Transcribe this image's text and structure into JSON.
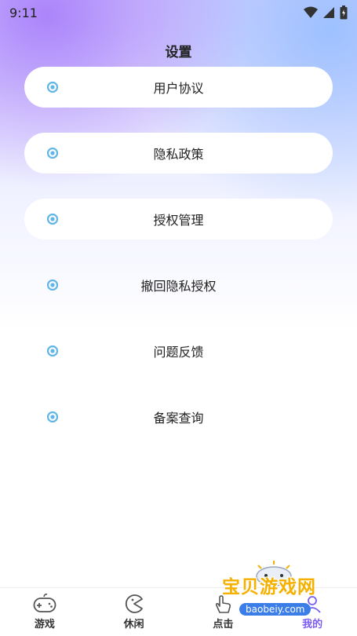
{
  "status_bar": {
    "time": "9:11"
  },
  "page": {
    "title": "设置"
  },
  "menu": [
    {
      "label": "用户协议"
    },
    {
      "label": "隐私政策"
    },
    {
      "label": "授权管理"
    },
    {
      "label": "撤回隐私授权"
    },
    {
      "label": "问题反馈"
    },
    {
      "label": "备案查询"
    }
  ],
  "tabbar": [
    {
      "label": "游戏",
      "icon": "gamepad-icon"
    },
    {
      "label": "休闲",
      "icon": "pacman-icon"
    },
    {
      "label": "点击",
      "icon": "tap-hand-icon"
    },
    {
      "label": "我的",
      "icon": "profile-icon",
      "active": true
    }
  ],
  "watermark": {
    "text": "宝贝游戏网",
    "url": "baobeiy.com"
  },
  "colors": {
    "accent": "#7b5cf0",
    "dot": "#5fb6e6"
  }
}
